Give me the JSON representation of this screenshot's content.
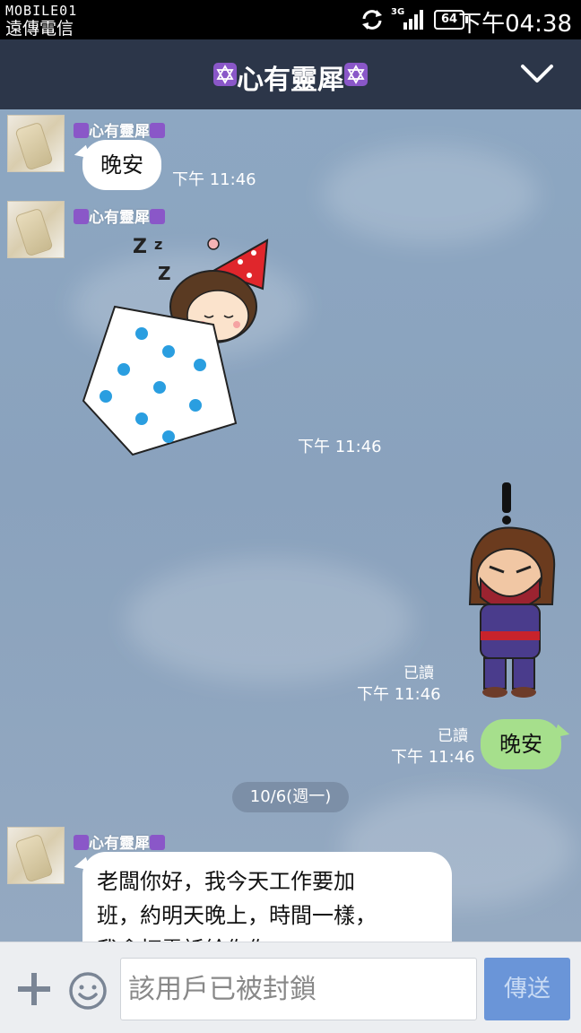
{
  "status_bar": {
    "carrier_top": "MOBILE01",
    "carrier_bottom": "遠傳電信",
    "network": "3G",
    "battery": "64",
    "clock": "下午04:38"
  },
  "header": {
    "title": "心有靈犀",
    "icons": [
      "hexagram-icon",
      "chevron-down-icon"
    ]
  },
  "messages": [
    {
      "sender": "心有靈犀",
      "text": "晚安",
      "time": "下午 11:46"
    },
    {
      "sender": "心有靈犀",
      "sticker": "sleeping-girl-sticker",
      "time": "下午 11:46"
    },
    {
      "self": true,
      "sticker": "ninja-sticker",
      "read": "已讀",
      "time": "下午 11:46"
    },
    {
      "self": true,
      "text": "晚安",
      "read": "已讀",
      "time": "下午 11:46"
    },
    {
      "sender": "心有靈犀",
      "text_lines": [
        "老闆你好，我今天工作要加",
        "班，約明天晚上，時間一樣，",
        "我會打電話給你你"
      ]
    }
  ],
  "date_divider": "10/6(週一)",
  "input_bar": {
    "placeholder": "該用戶已被封鎖",
    "send_label": "傳送"
  },
  "colors": {
    "header_bg": "#2c3649",
    "chat_bg": "#8da7c2",
    "outgoing_bubble": "#a6df8c",
    "incoming_bubble": "#ffffff",
    "send_button": "#6a95d8"
  }
}
